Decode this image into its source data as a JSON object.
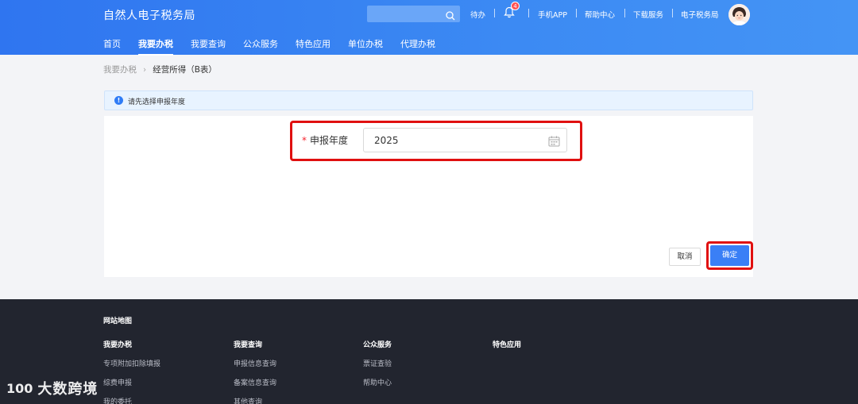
{
  "header": {
    "brand": "自然人电子税务局",
    "search": {
      "value": "",
      "placeholder": ""
    },
    "todo_label": "待办",
    "notification_count": "4",
    "links": [
      "手机APP",
      "帮助中心",
      "下载服务",
      "电子税务局"
    ]
  },
  "nav": {
    "items": [
      {
        "label": "首页"
      },
      {
        "label": "我要办税",
        "active": true
      },
      {
        "label": "我要查询"
      },
      {
        "label": "公众服务"
      },
      {
        "label": "特色应用"
      },
      {
        "label": "单位办税"
      },
      {
        "label": "代理办税"
      }
    ]
  },
  "breadcrumb": {
    "parent": "我要办税",
    "current": "经营所得（B表）"
  },
  "alert": {
    "text": "请先选择申报年度"
  },
  "form": {
    "required_mark": "*",
    "year_label": "申报年度",
    "year_value": "2025"
  },
  "actions": {
    "cancel": "取消",
    "confirm": "确定"
  },
  "footer": {
    "title": "网站地图",
    "columns": [
      {
        "head": "我要办税",
        "links": [
          "专项附加扣除填报",
          "综费申报",
          "我的委托"
        ]
      },
      {
        "head": "我要查询",
        "links": [
          "申报信息查询",
          "备案信息查询",
          "其他查询"
        ]
      },
      {
        "head": "公众服务",
        "links": [
          "票证查验",
          "帮助中心"
        ]
      },
      {
        "head": "特色应用",
        "links": []
      }
    ]
  },
  "watermark": {
    "logo": "100",
    "text": "大数跨境"
  },
  "colors": {
    "header_blue": "#2f75f0",
    "primary": "#3a7ff6",
    "highlight_red": "#e01010",
    "footer_bg": "#22252f"
  }
}
